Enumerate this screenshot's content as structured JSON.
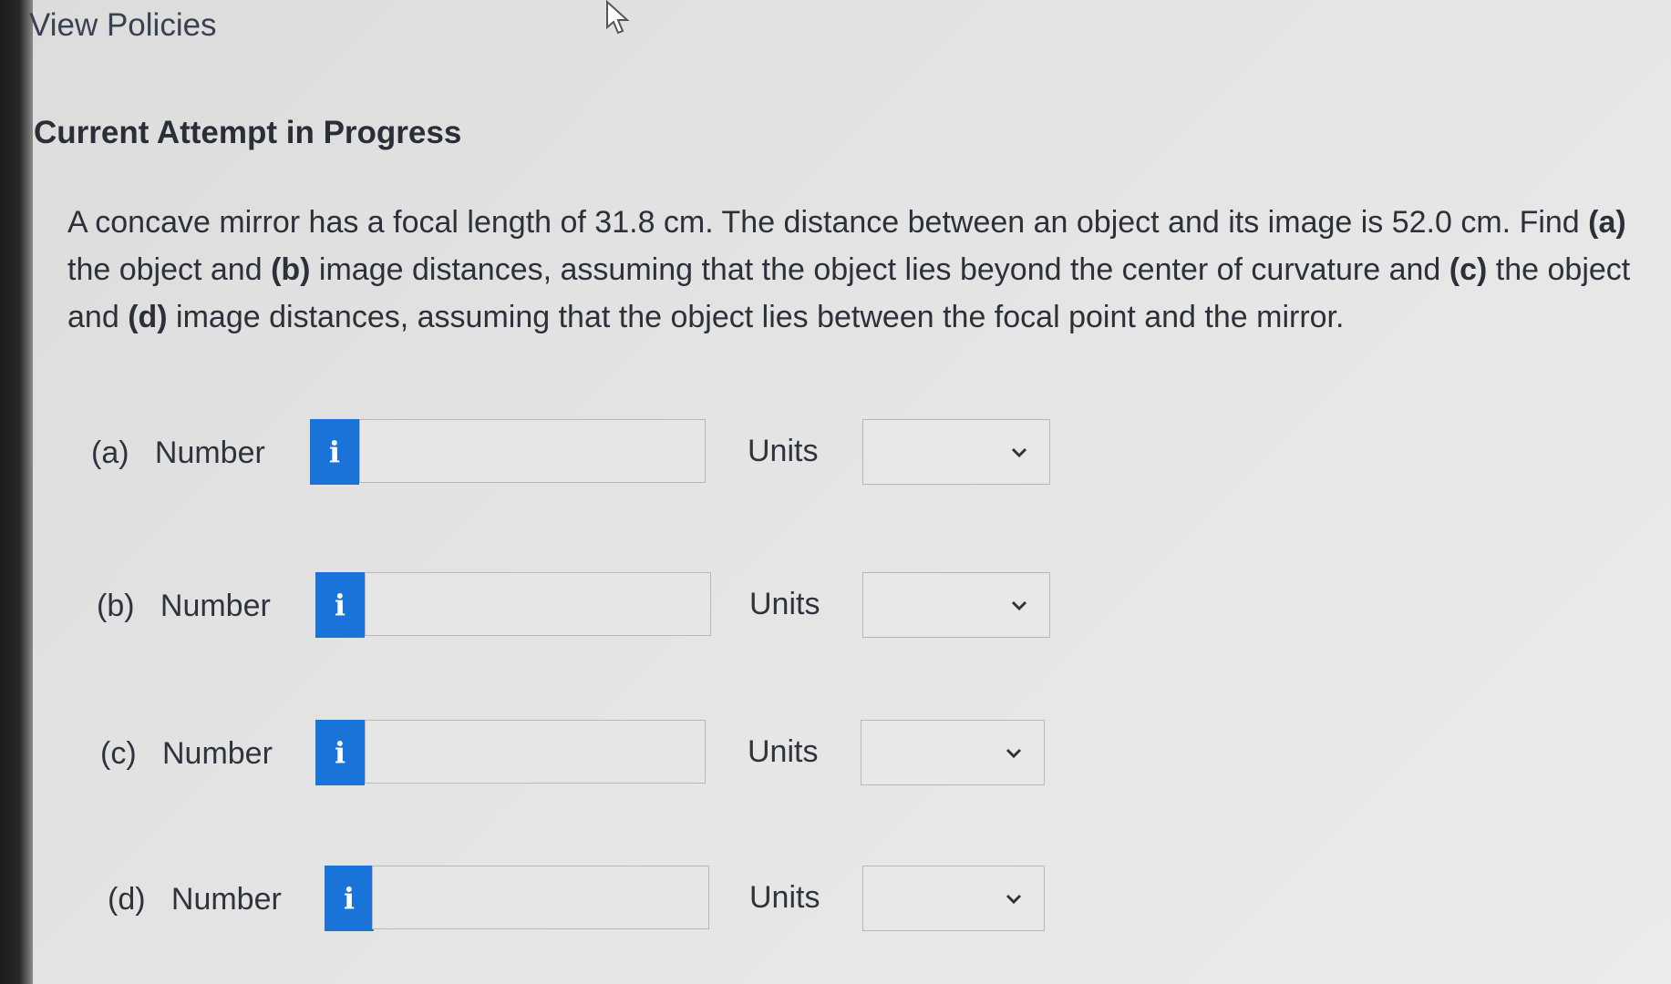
{
  "header": {
    "view_policies": "View Policies"
  },
  "heading": "Current Attempt in Progress",
  "question": {
    "segments": [
      {
        "text": "A concave mirror has a focal length of 31.8 cm. The distance between an object and its image is 52.0 cm. Find ",
        "bold": false
      },
      {
        "text": "(a)",
        "bold": true
      },
      {
        "text": " the object and ",
        "bold": false
      },
      {
        "text": "(b)",
        "bold": true
      },
      {
        "text": " image distances, assuming that the object lies beyond the center of curvature and ",
        "bold": false
      },
      {
        "text": "(c)",
        "bold": true
      },
      {
        "text": " the object and ",
        "bold": false
      },
      {
        "text": "(d)",
        "bold": true
      },
      {
        "text": " image distances, assuming that the object lies between the focal point and the mirror.",
        "bold": false
      }
    ]
  },
  "parts": [
    {
      "label": "(a)   Number",
      "info_icon": "i",
      "value": "",
      "units_label": "Units",
      "units_selected": ""
    },
    {
      "label": "(b)   Number",
      "info_icon": "i",
      "value": "",
      "units_label": "Units",
      "units_selected": ""
    },
    {
      "label": "(c)   Number",
      "info_icon": "i",
      "value": "",
      "units_label": "Units",
      "units_selected": ""
    },
    {
      "label": "(d)   Number",
      "info_icon": "i",
      "value": "",
      "units_label": "Units",
      "units_selected": ""
    }
  ],
  "colors": {
    "info_button": "#1a73d9",
    "background": "#e4e4e4"
  }
}
